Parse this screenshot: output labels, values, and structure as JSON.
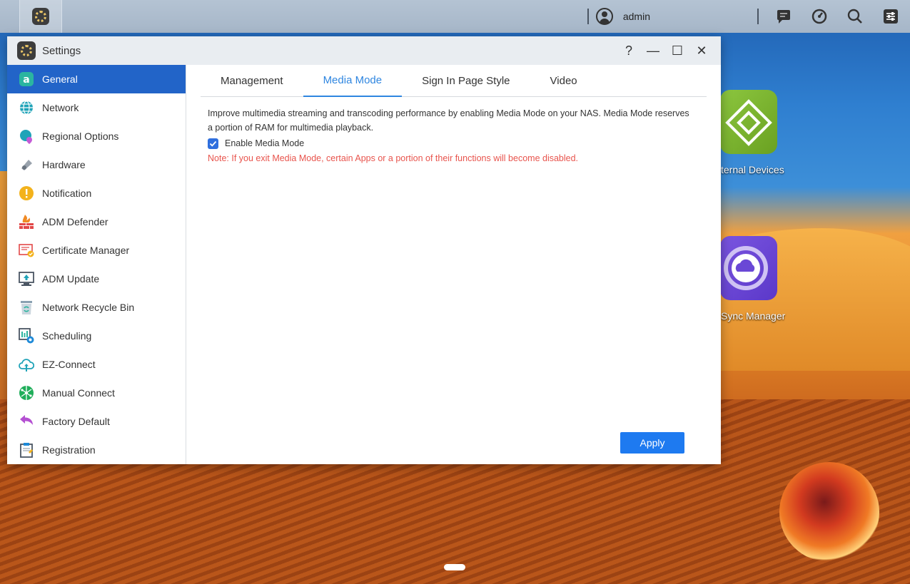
{
  "taskbar": {
    "user_name": "admin"
  },
  "desktop": {
    "external_devices_label": "ternal Devices",
    "sync_manager_label": "Sync Manager"
  },
  "window": {
    "title": "Settings",
    "help_glyph": "?",
    "minimize_glyph": "—",
    "maximize_glyph": "☐",
    "close_glyph": "✕"
  },
  "sidebar": {
    "items": [
      {
        "label": "General",
        "icon": "general-icon",
        "active": true
      },
      {
        "label": "Network",
        "icon": "globe-icon"
      },
      {
        "label": "Regional Options",
        "icon": "regional-icon"
      },
      {
        "label": "Hardware",
        "icon": "hardware-icon"
      },
      {
        "label": "Notification",
        "icon": "notification-icon"
      },
      {
        "label": "ADM Defender",
        "icon": "firewall-icon"
      },
      {
        "label": "Certificate Manager",
        "icon": "certificate-icon"
      },
      {
        "label": "ADM Update",
        "icon": "update-icon"
      },
      {
        "label": "Network Recycle Bin",
        "icon": "recycle-bin-icon"
      },
      {
        "label": "Scheduling",
        "icon": "scheduling-icon"
      },
      {
        "label": "EZ-Connect",
        "icon": "cloud-upload-icon"
      },
      {
        "label": "Manual Connect",
        "icon": "manual-connect-icon"
      },
      {
        "label": "Factory Default",
        "icon": "undo-icon"
      },
      {
        "label": "Registration",
        "icon": "registration-icon"
      }
    ]
  },
  "tabs": [
    {
      "label": "Management"
    },
    {
      "label": "Media Mode",
      "active": true
    },
    {
      "label": "Sign In Page Style"
    },
    {
      "label": "Video"
    }
  ],
  "media_mode": {
    "description": "Improve multimedia streaming and transcoding performance by enabling Media Mode on your NAS. Media Mode reserves a portion of RAM for multimedia playback.",
    "checkbox_label": "Enable Media Mode",
    "checkbox_checked": true,
    "note": "Note: If you exit Media Mode, certain Apps or a portion of their functions will become disabled.",
    "apply_label": "Apply"
  },
  "colors": {
    "accent": "#2264c8",
    "tab_active": "#2f86e0",
    "note_red": "#e8544d",
    "apply_blue": "#1e7af0"
  }
}
